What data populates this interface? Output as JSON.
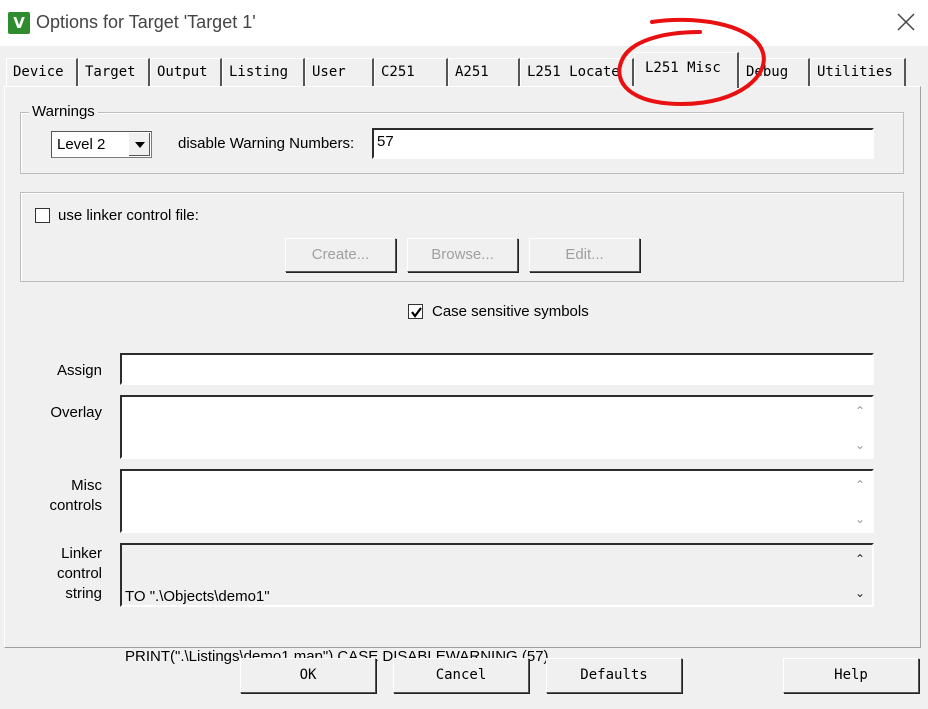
{
  "window": {
    "title": "Options for Target 'Target 1'",
    "app_icon_glyph": "V"
  },
  "tabs": [
    {
      "label": "Device"
    },
    {
      "label": "Target"
    },
    {
      "label": "Output"
    },
    {
      "label": "Listing"
    },
    {
      "label": "User"
    },
    {
      "label": "C251"
    },
    {
      "label": "A251"
    },
    {
      "label": "L251 Locate"
    },
    {
      "label": "L251 Misc",
      "active": true
    },
    {
      "label": "Debug"
    },
    {
      "label": "Utilities"
    }
  ],
  "warnings": {
    "group_label": "Warnings",
    "level_value": "Level 2",
    "disable_label": "disable Warning Numbers:",
    "disable_value": "57"
  },
  "linker_file": {
    "checkbox_label": "use linker control file:",
    "checked": false,
    "create_label": "Create...",
    "browse_label": "Browse...",
    "edit_label": "Edit..."
  },
  "case_sensitive": {
    "label": "Case sensitive symbols",
    "checked": true
  },
  "fields": {
    "assign_label": "Assign",
    "assign_value": "",
    "overlay_label": "Overlay",
    "overlay_value": "",
    "misc_label_line1": "Misc",
    "misc_label_line2": "controls",
    "misc_value": "",
    "linker_label_line1": "Linker",
    "linker_label_line2": "control",
    "linker_label_line3": "string",
    "linker_line1": "TO \".\\Objects\\demo1\"",
    "linker_line2": "PRINT(\".\\Listings\\demo1.map\") CASE DISABLEWARNING (57)"
  },
  "buttons": {
    "ok": "OK",
    "cancel": "Cancel",
    "defaults": "Defaults",
    "help": "Help"
  },
  "annotation_color": "#e81010"
}
